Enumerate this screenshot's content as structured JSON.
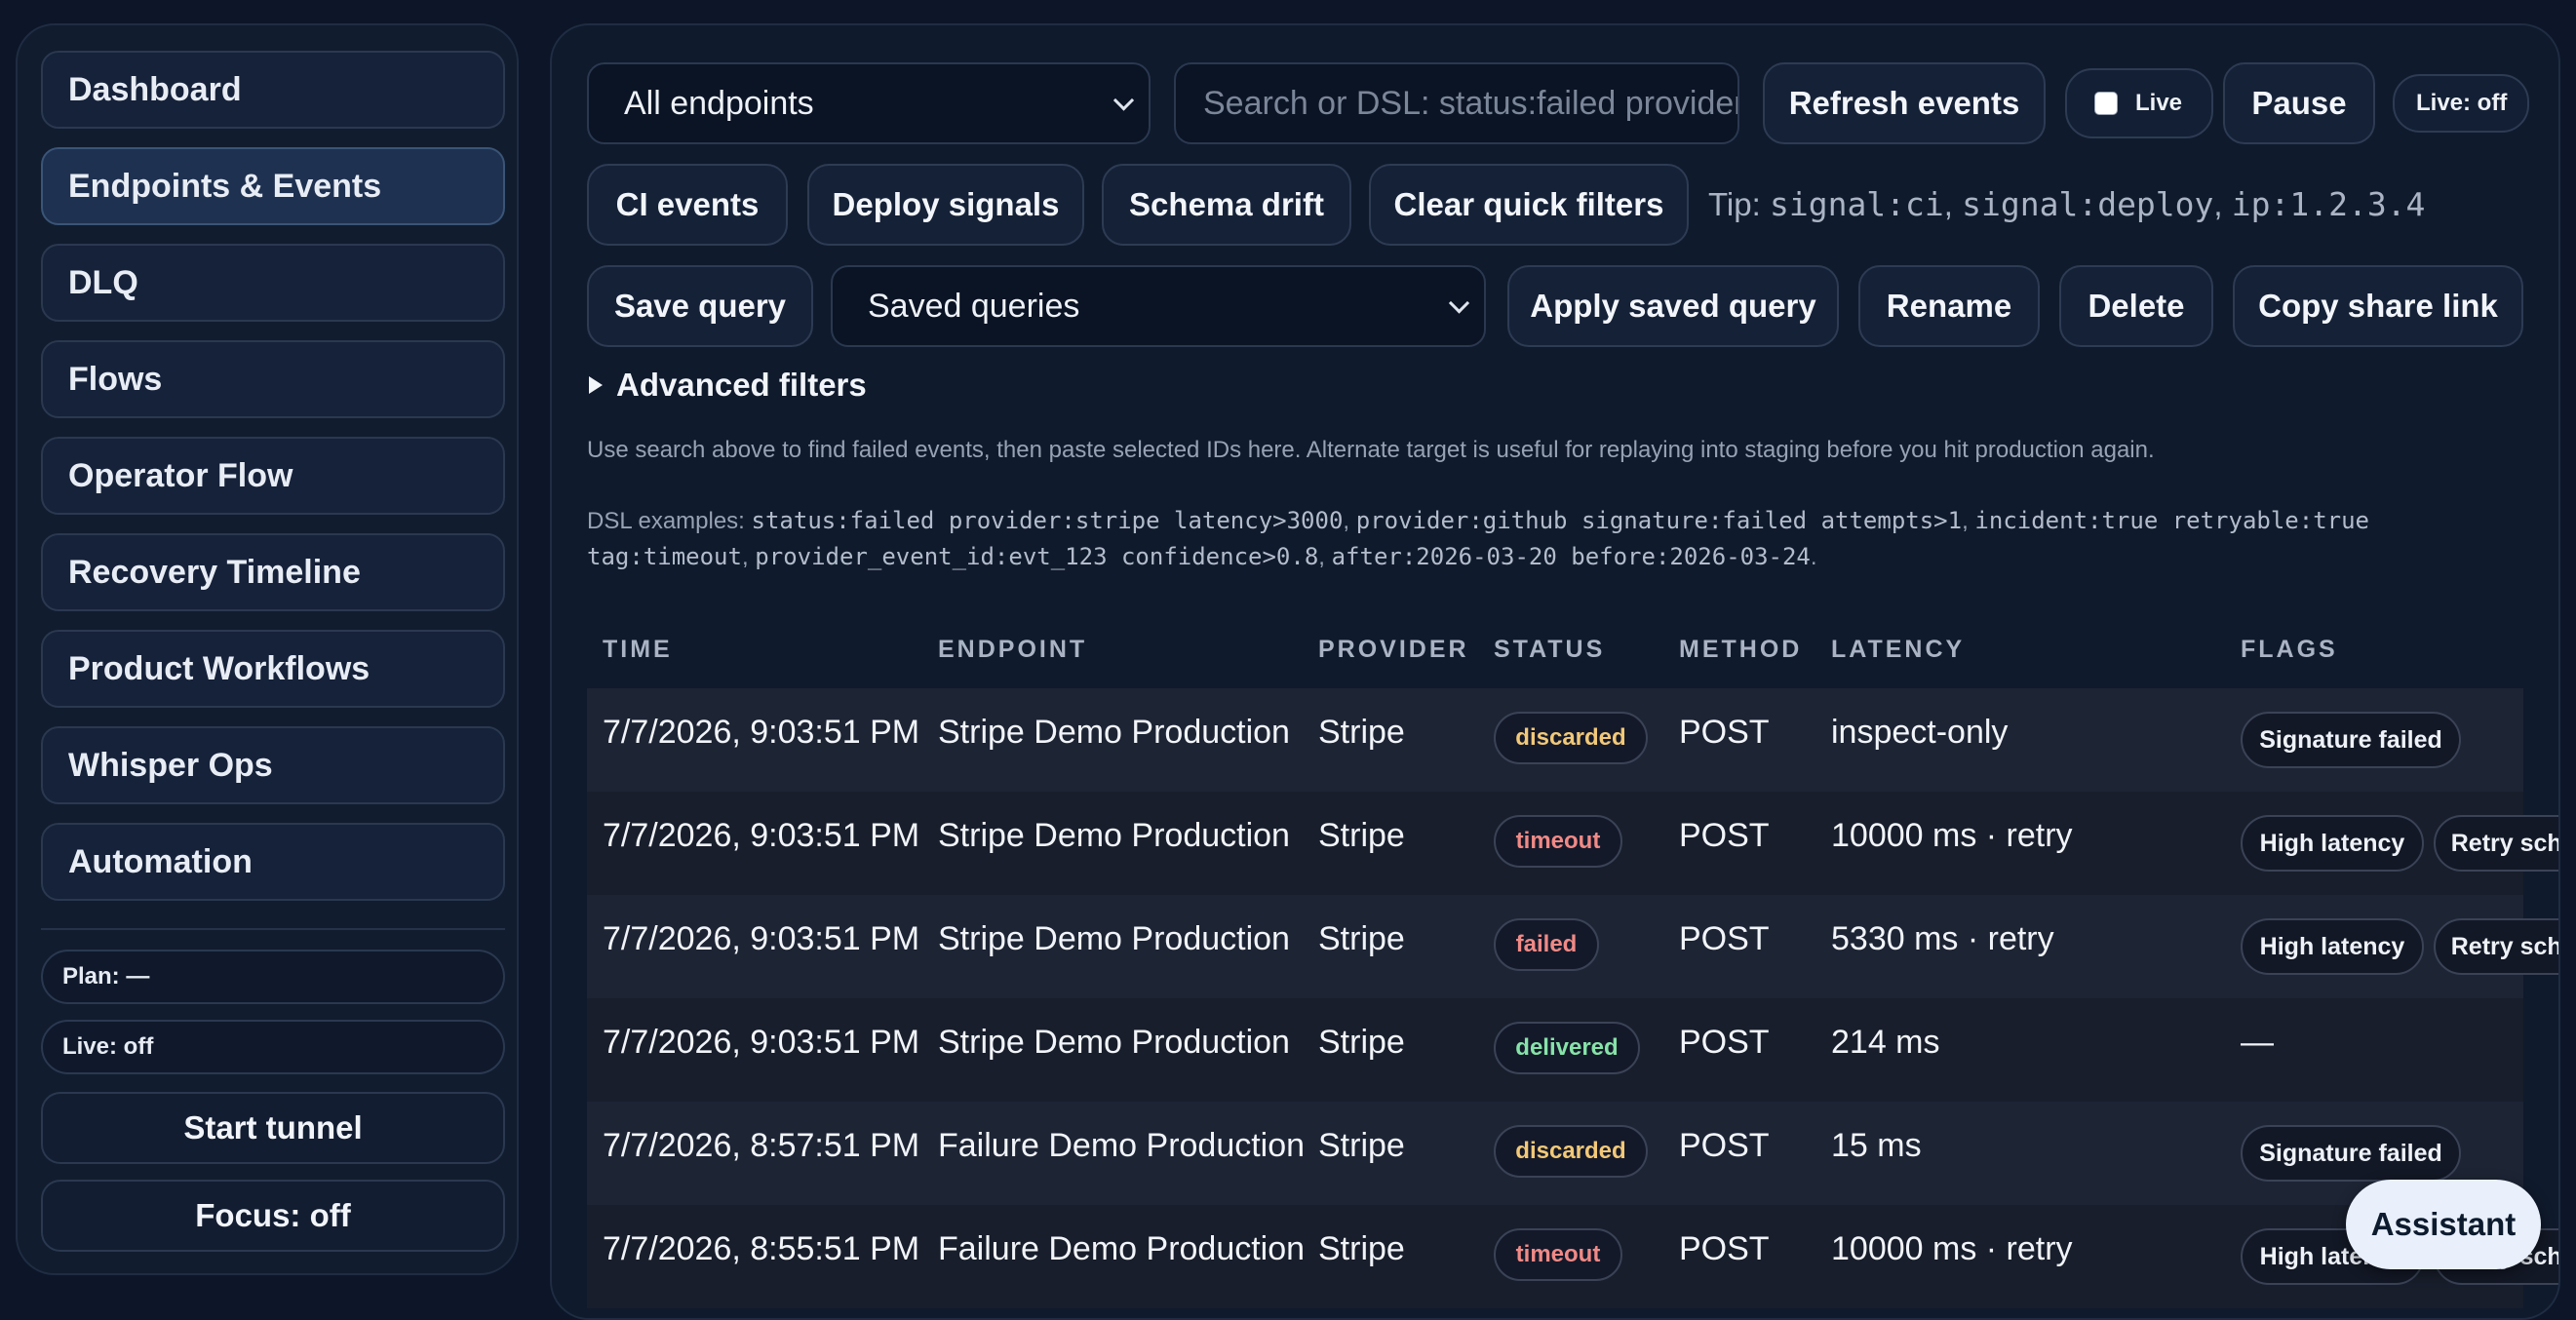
{
  "sidebar": {
    "items": [
      {
        "label": "Dashboard"
      },
      {
        "label": "Endpoints & Events",
        "active": true
      },
      {
        "label": "DLQ"
      },
      {
        "label": "Flows"
      },
      {
        "label": "Operator Flow"
      },
      {
        "label": "Recovery Timeline"
      },
      {
        "label": "Product Workflows"
      },
      {
        "label": "Whisper Ops"
      },
      {
        "label": "Automation"
      }
    ],
    "plan_label": "Plan: —",
    "live_label": "Live: off",
    "start_tunnel_label": "Start tunnel",
    "focus_label": "Focus: off"
  },
  "toolbar": {
    "endpoint_select_value": "All endpoints",
    "search_placeholder": "Search or DSL: status:failed provider",
    "refresh_label": "Refresh events",
    "live_checkbox_label": "Live",
    "live_checked": false,
    "pause_label": "Pause",
    "live_status": "Live: off"
  },
  "quick_filters": {
    "ci_label": "CI events",
    "deploy_label": "Deploy signals",
    "schema_label": "Schema drift",
    "clear_label": "Clear quick filters",
    "tip_prefix": "Tip:",
    "tip_code_1": "signal:ci",
    "tip_code_2": "signal:deploy",
    "tip_code_3": "ip:1.2.3.4",
    "tip_sep": ","
  },
  "saved": {
    "save_label": "Save query",
    "select_value": "Saved queries",
    "apply_label": "Apply saved query",
    "rename_label": "Rename",
    "delete_label": "Delete",
    "share_label": "Copy share link"
  },
  "advanced": {
    "label": "Advanced filters"
  },
  "note": "Use search above to find failed events, then paste selected IDs here. Alternate target is useful for replaying into staging before you hit production again.",
  "dsl": {
    "prefix": "DSL examples:",
    "ex1": "status:failed provider:stripe latency>3000",
    "ex2": "provider:github signature:failed attempts>1",
    "ex3": "incident:true retryable:true",
    "ex4": "tag:timeout",
    "ex5": "provider_event_id:evt_123 confidence>0.8",
    "ex6": "after:2026-03-20 before:2026-03-24",
    "sep": ",",
    "end": "."
  },
  "table": {
    "headers": {
      "time": "TIME",
      "endpoint": "ENDPOINT",
      "provider": "PROVIDER",
      "status": "STATUS",
      "method": "METHOD",
      "latency": "LATENCY",
      "flags": "FLAGS"
    },
    "rows": [
      {
        "time": "7/7/2026, 9:03:51 PM",
        "endpoint": "Stripe Demo Production",
        "provider": "Stripe",
        "status": "discarded",
        "method": "POST",
        "latency": "inspect-only",
        "flag1": "Signature failed",
        "flag2": ""
      },
      {
        "time": "7/7/2026, 9:03:51 PM",
        "endpoint": "Stripe Demo Production",
        "provider": "Stripe",
        "status": "timeout",
        "method": "POST",
        "latency": "10000 ms · retry",
        "flag1": "High latency",
        "flag2": "Retry scheduled"
      },
      {
        "time": "7/7/2026, 9:03:51 PM",
        "endpoint": "Stripe Demo Production",
        "provider": "Stripe",
        "status": "failed",
        "method": "POST",
        "latency": "5330 ms · retry",
        "flag1": "High latency",
        "flag2": "Retry scheduled"
      },
      {
        "time": "7/7/2026, 9:03:51 PM",
        "endpoint": "Stripe Demo Production",
        "provider": "Stripe",
        "status": "delivered",
        "method": "POST",
        "latency": "214 ms",
        "flag_none": "—"
      },
      {
        "time": "7/7/2026, 8:57:51 PM",
        "endpoint": "Failure Demo Production",
        "provider": "Stripe",
        "status": "discarded",
        "method": "POST",
        "latency": "15 ms",
        "flag1": "Signature failed",
        "flag2": ""
      },
      {
        "time": "7/7/2026, 8:55:51 PM",
        "endpoint": "Failure Demo Production",
        "provider": "Stripe",
        "status": "timeout",
        "method": "POST",
        "latency": "10000 ms · retry",
        "flag1": "High latency",
        "flag2": "Retry scheduled"
      }
    ]
  },
  "status_colors": {
    "discarded": "#f2c978",
    "timeout": "#f08a86",
    "failed": "#f08a86",
    "delivered": "#86e3a8"
  },
  "assistant_label": "Assistant"
}
